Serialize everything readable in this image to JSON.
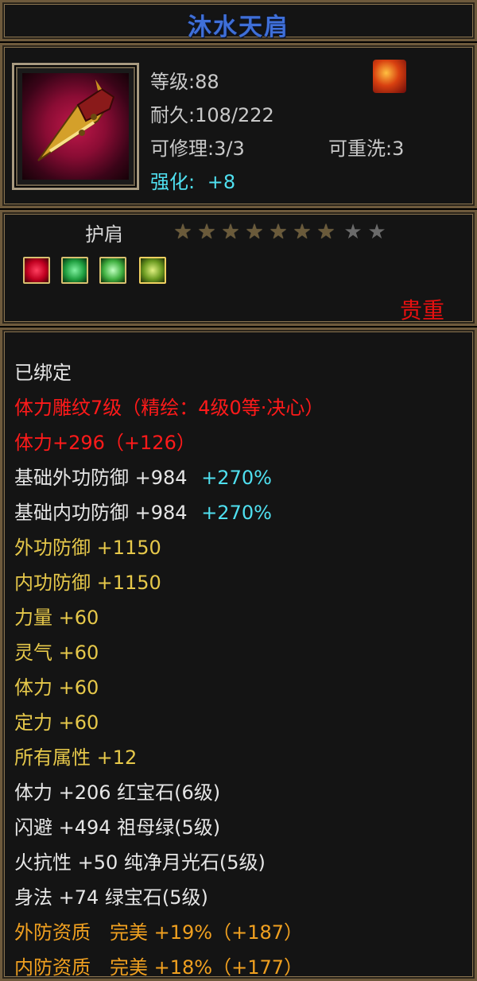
{
  "item": {
    "name": "沐水天肩",
    "level_label": "等级:88",
    "durability_label": "耐久:108/222",
    "repair_label": "可修理:3/3",
    "rewash_label": "可重洗:3",
    "enhance_label": "强化:",
    "enhance_value": "+8",
    "type": "护肩",
    "stars_total": 9,
    "stars_filled": 7,
    "rarity": "贵重"
  },
  "gems": [
    "ruby-gem-icon",
    "emerald-gem-icon",
    "green-gem-icon",
    "moonstone-gem-icon"
  ],
  "colors": {
    "title": "#3f6fd8",
    "red": "#ff1a1a",
    "yellow": "#e6c84a",
    "cyan": "#4fe0f0",
    "orange": "#f0a020"
  },
  "attributes": [
    {
      "text": "已绑定",
      "color": "white"
    },
    {
      "text": "体力雕纹7级（精绘：4级0等·决心）",
      "color": "red"
    },
    {
      "text": "体力+296（+126）",
      "color": "red"
    },
    {
      "text": "基础外功防御 +984",
      "extra": "+270%",
      "color": "white"
    },
    {
      "text": "基础内功防御 +984",
      "extra": "+270%",
      "color": "white"
    },
    {
      "text": "外功防御 +1150",
      "color": "yellow"
    },
    {
      "text": "内功防御 +1150",
      "color": "yellow"
    },
    {
      "text": "力量 +60",
      "color": "yellow"
    },
    {
      "text": "灵气 +60",
      "color": "yellow"
    },
    {
      "text": "体力 +60",
      "color": "yellow"
    },
    {
      "text": "定力 +60",
      "color": "yellow"
    },
    {
      "text": "所有属性 +12",
      "color": "yellow"
    },
    {
      "text": "体力 +206 红宝石(6级)",
      "color": "white"
    },
    {
      "text": "闪避 +494 祖母绿(5级)",
      "color": "white"
    },
    {
      "text": "火抗性 +50 纯净月光石(5级)",
      "color": "white"
    },
    {
      "text": "身法 +74 绿宝石(5级)",
      "color": "white"
    },
    {
      "text": "外防资质　完美 +19%（+187）",
      "color": "orange"
    },
    {
      "text": "内防资质　完美 +18%（+177）",
      "color": "orange"
    }
  ]
}
